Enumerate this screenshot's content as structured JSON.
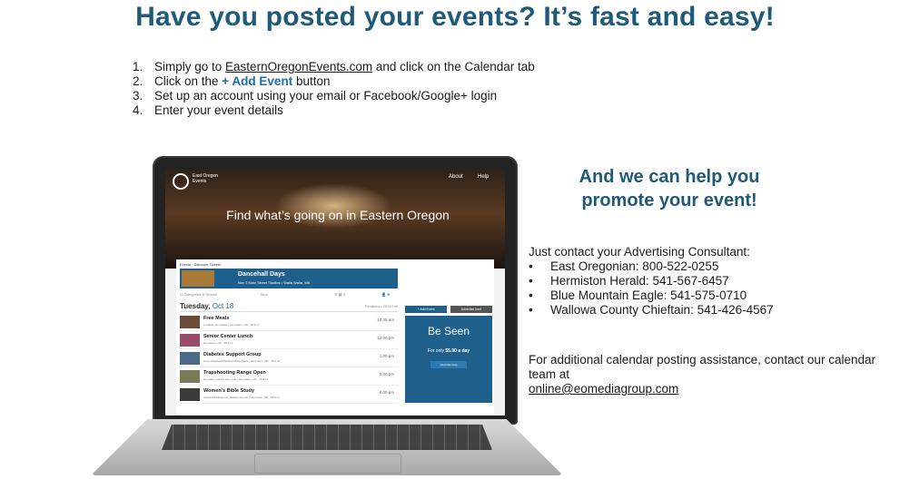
{
  "headline": "Have you posted your events? It’s fast and easy!",
  "steps": [
    {
      "num": "1.",
      "pre": "Simply go to ",
      "link": "EasternOregonEvents.com",
      "post": " and click on the Calendar tab"
    },
    {
      "num": "2.",
      "pre": "Click on the ",
      "highlight": "+ Add Event",
      "post": " button"
    },
    {
      "num": "3.",
      "text": "Set up an account using your email or Facebook/Google+ login"
    },
    {
      "num": "4.",
      "text": "Enter your event details"
    }
  ],
  "promo": "And we can help you promote your event!",
  "contact_intro": "Just contact your Advertising Consultant:",
  "contacts": [
    "East Oregonian: 800-522-0255",
    "Hermiston Herald: 541-567-6457",
    "Blue Mountain Eagle: 541-575-0710",
    "Wallowa County Chieftain: 541-426-4567"
  ],
  "bullet": "•",
  "assist_text": "For additional calendar posting assistance, contact our calendar team at",
  "assist_email": "online@eomediagroup.com",
  "screen": {
    "brand": "East Oregon\nEvents",
    "nav_about": "About",
    "nav_help": "Help",
    "tagline": "Find what’s going on in Eastern Oregon",
    "crumb": "Events · Discount Tickets",
    "featured_title": "Dancehall Days",
    "featured_sub": "Nov 5   Main Street Studios   • Walla Walla, WA",
    "search_placeholder": "Q Categories & Search",
    "time_placeholder": "Time",
    "day": "Tuesday,",
    "day_date": "Oct 18",
    "location": "Pendleton, OR",
    "radius": "20 mi",
    "add_event_btn": "+ Add Event",
    "advertise_btn": "Advertise here",
    "ad_big": "Be Seen",
    "ad_small_pre": "For only ",
    "ad_small_price": "$5.00 a day",
    "ad_mini": "Advertise here",
    "events": [
      {
        "name": "Free Meals",
        "sub": "Location: Hermiston | Hermiston, OR  · 28.9 mi",
        "time": "10:45 am"
      },
      {
        "name": "Senior Center Lunch",
        "sub": "Hermiston, OR  · 28.9 mi",
        "time": "12:00 pm"
      },
      {
        "name": "Diabetes Support Group",
        "sub": "Good Shepherd Medical Office Plaza | Hermiston, OR  · 28.9 mi",
        "time": "1:00 pm"
      },
      {
        "name": "Trapshooting Range Open",
        "sub": "Hermiston Rod & Gun Club | Hermiston, OR  · 28.9 mi",
        "time": "5:00 pm"
      },
      {
        "name": "Women’s Bible Study",
        "sub": "Landmark Missionary Baptist Church | Hermiston, OR  · 28.9 mi",
        "time": "6:00 pm"
      }
    ]
  },
  "colors": {
    "heading": "#1f5a78",
    "brand_blue": "#1f5f8b",
    "link_blue": "#1f6ea8"
  }
}
